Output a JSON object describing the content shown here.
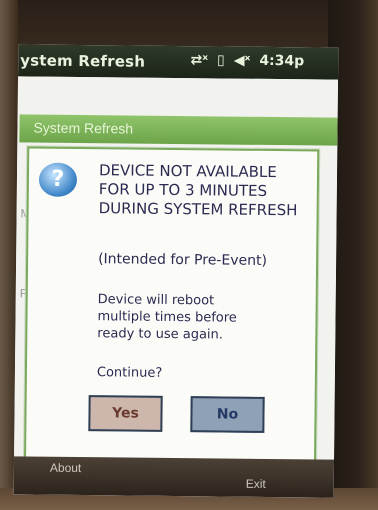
{
  "status_bar": {
    "app_title": "ystem Refresh",
    "icons": [
      "connectivity-icon",
      "battery-icon",
      "speaker-muted-icon"
    ],
    "time": "4:34p"
  },
  "background": {
    "panel_title": "System Refresh",
    "fragments": [
      "Ma",
      "R"
    ]
  },
  "dialog": {
    "icon": "question-icon",
    "message_line1": "DEVICE NOT AVAILABLE",
    "message_line2": "FOR UP TO 3 MINUTES",
    "message_line3": "DURING SYSTEM REFRESH",
    "intended": "(Intended for Pre-Event)",
    "reboot_line1": "Device will reboot",
    "reboot_line2": "multiple times before",
    "reboot_line3": "ready to use again.",
    "continue_prompt": "Continue?",
    "yes_label": "Yes",
    "no_label": "No"
  },
  "softkeys": {
    "left": "About",
    "right": "Exit"
  }
}
